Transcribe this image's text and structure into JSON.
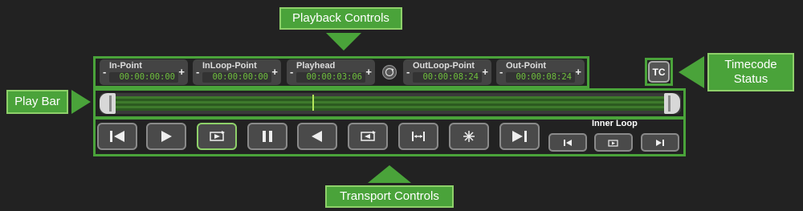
{
  "callouts": {
    "playback_controls": "Playback Controls",
    "play_bar": "Play Bar",
    "timecode_status": "Timecode Status",
    "transport_controls": "Transport Controls"
  },
  "timecode_fields": [
    {
      "label": "In-Point",
      "value": "00:00:00:00",
      "minus": "-",
      "plus": "+"
    },
    {
      "label": "InLoop-Point",
      "value": "00:00:00:00",
      "minus": "-",
      "plus": "+"
    },
    {
      "label": "Playhead",
      "value": "00:00:03:06",
      "minus": "-",
      "plus": "+"
    },
    {
      "label": "OutLoop-Point",
      "value": "00:00:08:24",
      "minus": "-",
      "plus": "+"
    },
    {
      "label": "Out-Point",
      "value": "00:00:08:24",
      "minus": "-",
      "plus": "+"
    }
  ],
  "timecode_status_label": "TC",
  "inner_loop_label": "Inner Loop",
  "colors": {
    "accent": "#4aa33a",
    "accent_light": "#8ed06a",
    "timecode_text": "#6fbf3e",
    "background": "#222222"
  },
  "icons": [
    "skip-to-start-icon",
    "play-icon",
    "loop-play-icon",
    "pause-icon",
    "reverse-play-icon",
    "loop-reverse-icon",
    "fit-range-icon",
    "freeze-icon",
    "skip-to-end-icon",
    "inner-loop-start-icon",
    "inner-loop-play-icon",
    "inner-loop-end-icon"
  ]
}
